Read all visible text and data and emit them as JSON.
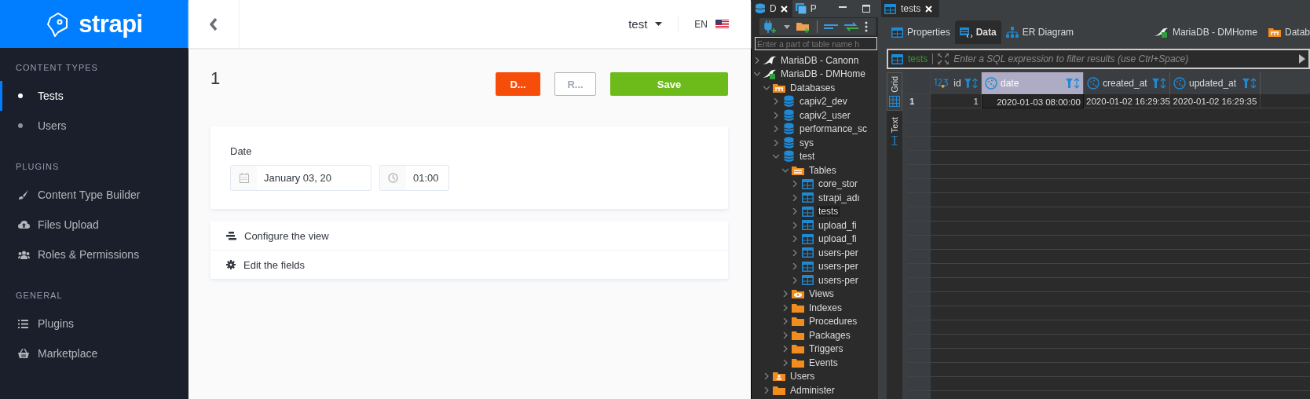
{
  "sidebar": {
    "brand": "strapi",
    "sections": [
      {
        "heading": "CONTENT TYPES",
        "items": [
          {
            "label": "Tests",
            "kind": "dot",
            "selected": true
          },
          {
            "label": "Users",
            "kind": "dot",
            "selected": false
          }
        ]
      },
      {
        "heading": "PLUGINS",
        "items": [
          {
            "label": "Content Type Builder",
            "kind": "brush",
            "selected": false
          },
          {
            "label": "Files Upload",
            "kind": "cloud",
            "selected": false
          },
          {
            "label": "Roles & Permissions",
            "kind": "people",
            "selected": false
          }
        ]
      },
      {
        "heading": "GENERAL",
        "items": [
          {
            "label": "Plugins",
            "kind": "list",
            "selected": false
          },
          {
            "label": "Marketplace",
            "kind": "basket",
            "selected": false
          }
        ]
      }
    ]
  },
  "header": {
    "user": "test",
    "language": "EN"
  },
  "entry": {
    "title": "1",
    "buttons": [
      {
        "label": "D...",
        "kind": "danger"
      },
      {
        "label": "R...",
        "kind": "secondary"
      },
      {
        "label": "Save",
        "kind": "primary"
      }
    ],
    "field": {
      "label": "Date",
      "date": "January 03, 20",
      "time": "01:00"
    },
    "links": [
      {
        "label": "Configure the view",
        "kind": "layout"
      },
      {
        "label": "Edit the fields",
        "kind": "gear"
      }
    ]
  },
  "navigator": {
    "tabs": [
      {
        "label": "D",
        "selected": true
      },
      {
        "label": "P",
        "selected": false
      }
    ],
    "search_placeholder": "Enter a part of table name h",
    "tree": [
      {
        "label": "MariaDB - Canonn",
        "kind": "connection",
        "expanded": false,
        "selected": false
      },
      {
        "label": "MariaDB - DMHome",
        "kind": "connection-ok",
        "expanded": true,
        "selected": false,
        "children": [
          {
            "label": "Databases",
            "kind": "databases",
            "expanded": true,
            "selected": false,
            "children": [
              {
                "label": "capiv2_dev",
                "kind": "database",
                "expanded": false,
                "selected": false
              },
              {
                "label": "capiv2_user",
                "kind": "database",
                "expanded": false,
                "selected": false
              },
              {
                "label": "performance_sc",
                "kind": "database",
                "expanded": false,
                "selected": false
              },
              {
                "label": "sys",
                "kind": "database",
                "expanded": false,
                "selected": false
              },
              {
                "label": "test",
                "kind": "database",
                "expanded": true,
                "selected": false,
                "children": [
                  {
                    "label": "Tables",
                    "kind": "tables",
                    "expanded": true,
                    "selected": false,
                    "children": [
                      {
                        "label": "core_stor",
                        "kind": "table",
                        "expanded": false,
                        "selected": false
                      },
                      {
                        "label": "strapi_adı",
                        "kind": "table",
                        "expanded": false,
                        "selected": false
                      },
                      {
                        "label": "tests",
                        "kind": "table",
                        "expanded": false,
                        "selected": true
                      },
                      {
                        "label": "upload_fi",
                        "kind": "table",
                        "expanded": false,
                        "selected": false
                      },
                      {
                        "label": "upload_fi",
                        "kind": "table",
                        "expanded": false,
                        "selected": false
                      },
                      {
                        "label": "users-per",
                        "kind": "table",
                        "expanded": false,
                        "selected": false
                      },
                      {
                        "label": "users-per",
                        "kind": "table",
                        "expanded": false,
                        "selected": false
                      },
                      {
                        "label": "users-per",
                        "kind": "table",
                        "expanded": false,
                        "selected": false
                      }
                    ]
                  },
                  {
                    "label": "Views",
                    "kind": "views",
                    "expanded": false,
                    "selected": false
                  },
                  {
                    "label": "Indexes",
                    "kind": "folder",
                    "expanded": false,
                    "selected": false
                  },
                  {
                    "label": "Procedures",
                    "kind": "folder",
                    "expanded": false,
                    "selected": false
                  },
                  {
                    "label": "Packages",
                    "kind": "folder",
                    "expanded": false,
                    "selected": false
                  },
                  {
                    "label": "Triggers",
                    "kind": "folder",
                    "expanded": false,
                    "selected": false
                  },
                  {
                    "label": "Events",
                    "kind": "folder",
                    "expanded": false,
                    "selected": false
                  }
                ]
              }
            ]
          },
          {
            "label": "Users",
            "kind": "users",
            "expanded": false,
            "selected": false
          },
          {
            "label": "Administer",
            "kind": "folder",
            "expanded": false,
            "selected": false
          }
        ]
      }
    ]
  },
  "editor": {
    "tab": "tests",
    "subtabs": [
      {
        "label": "Properties",
        "kind": "table",
        "selected": false
      },
      {
        "label": "Data",
        "kind": "data",
        "selected": true
      },
      {
        "label": "ER Diagram",
        "kind": "diagram",
        "selected": false
      }
    ],
    "breadcrumbs": [
      {
        "label": "MariaDB - DMHome",
        "kind": "connection"
      },
      {
        "label": "Datab",
        "kind": "databases"
      }
    ],
    "filter": {
      "entity": "tests",
      "placeholder": "Enter a SQL expression to filter results (use Ctrl+Space)"
    },
    "side_tabs": [
      {
        "label": "Grid",
        "selected": true
      },
      {
        "label": "Text",
        "selected": false
      }
    ],
    "grid": {
      "columns": [
        {
          "name": "id",
          "kind": "number",
          "selected": false
        },
        {
          "name": "date",
          "kind": "datetime",
          "selected": true
        },
        {
          "name": "created_at",
          "kind": "datetime",
          "selected": false
        },
        {
          "name": "updated_at",
          "kind": "datetime",
          "selected": false
        }
      ],
      "rows": [
        {
          "number": "1",
          "cells": [
            "1",
            "2020-01-03 08:00:00",
            "2020-01-02 16:29:35",
            "2020-01-02 16:29:35"
          ]
        }
      ]
    }
  }
}
